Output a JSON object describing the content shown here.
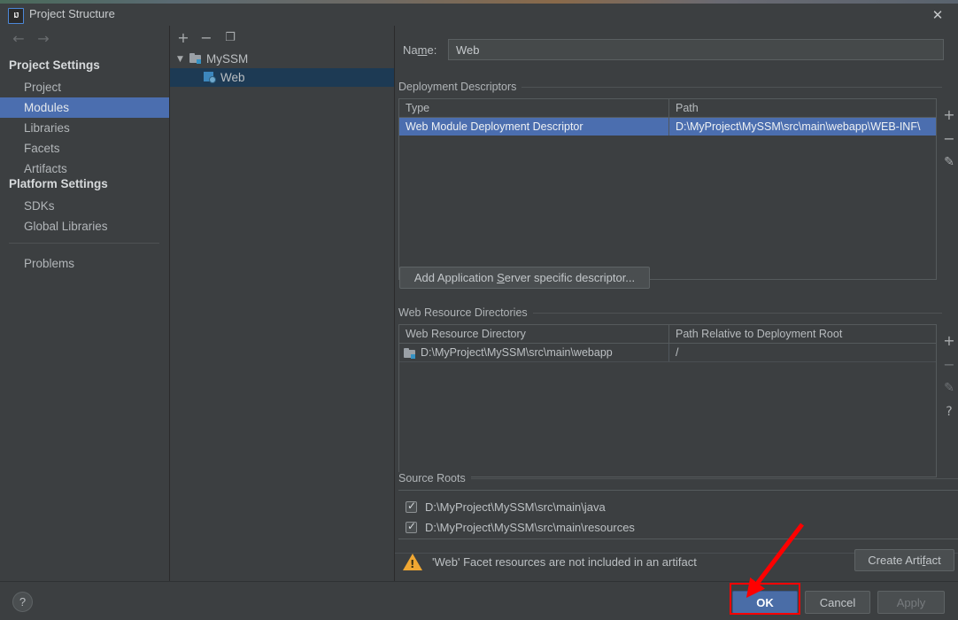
{
  "window": {
    "title": "Project Structure",
    "app_icon": "intellij-idea-icon",
    "close_icon": "✕"
  },
  "sidebar": {
    "nav": {
      "back_icon": "←",
      "forward_icon": "→"
    },
    "groups": [
      {
        "label": "Project Settings",
        "items": [
          {
            "label": "Project",
            "selected": false
          },
          {
            "label": "Modules",
            "selected": true
          },
          {
            "label": "Libraries",
            "selected": false
          },
          {
            "label": "Facets",
            "selected": false
          },
          {
            "label": "Artifacts",
            "selected": false
          }
        ]
      },
      {
        "label": "Platform Settings",
        "items": [
          {
            "label": "SDKs",
            "selected": false
          },
          {
            "label": "Global Libraries",
            "selected": false
          }
        ]
      }
    ],
    "problems": {
      "label": "Problems"
    }
  },
  "tree_pane": {
    "toolbar": [
      {
        "name": "add-module-button",
        "glyph": "+"
      },
      {
        "name": "remove-module-button",
        "glyph": "−"
      },
      {
        "name": "copy-module-button",
        "glyph": "❐"
      }
    ],
    "nodes": [
      {
        "label": "MySSM",
        "expand_glyph": "▼",
        "selected": false
      },
      {
        "label": "Web",
        "selected": true
      }
    ]
  },
  "main": {
    "name_field": {
      "label": "Name:",
      "label_pre": "Na",
      "label_accel": "m",
      "label_post": "e:",
      "value": "Web"
    },
    "deployment_descriptors": {
      "title": "Deployment Descriptors",
      "columns": [
        "Type",
        "Path"
      ],
      "rows": [
        {
          "type": "Web Module Deployment Descriptor",
          "path": "D:\\MyProject\\MySSM\\src\\main\\webapp\\WEB-INF\\",
          "selected": true
        }
      ],
      "actions": [
        {
          "name": "add-descriptor-button",
          "glyph": "+",
          "dim": false
        },
        {
          "name": "remove-descriptor-button",
          "glyph": "−",
          "dim": false
        },
        {
          "name": "edit-descriptor-button",
          "glyph": "✎",
          "dim": false
        }
      ],
      "add_server_button": {
        "pre": "Add Application ",
        "accel": "S",
        "post": "erver specific descriptor..."
      }
    },
    "web_resource_directories": {
      "title": "Web Resource Directories",
      "columns": [
        "Web Resource Directory",
        "Path Relative to Deployment Root"
      ],
      "rows": [
        {
          "directory": "D:\\MyProject\\MySSM\\src\\main\\webapp",
          "relative_path": "/"
        }
      ],
      "actions": [
        {
          "name": "add-web-resource-button",
          "glyph": "+",
          "dim": false
        },
        {
          "name": "remove-web-resource-button",
          "glyph": "−",
          "dim": true
        },
        {
          "name": "edit-web-resource-button",
          "glyph": "✎",
          "dim": true
        },
        {
          "name": "help-web-resource-button",
          "glyph": "?",
          "dim": false
        }
      ]
    },
    "source_roots": {
      "title": "Source Roots",
      "items": [
        {
          "label": "D:\\MyProject\\MySSM\\src\\main\\java",
          "checked": true
        },
        {
          "label": "D:\\MyProject\\MySSM\\src\\main\\resources",
          "checked": true
        }
      ]
    },
    "warning": {
      "icon": "warning-triangle-icon",
      "text": "'Web' Facet resources are not included in an artifact",
      "button": {
        "pre": "Create Arti",
        "accel": "f",
        "post": "act"
      }
    }
  },
  "footer": {
    "help_glyph": "?",
    "buttons": [
      {
        "name": "ok-button",
        "label": "OK",
        "style": "primary",
        "disabled": false
      },
      {
        "name": "cancel-button",
        "label": "Cancel",
        "style": "normal",
        "disabled": false
      },
      {
        "name": "apply-button",
        "label": "Apply",
        "style": "normal",
        "disabled": true
      }
    ]
  },
  "annotation": {
    "highlight_color": "#ff0000",
    "target": "ok-button"
  },
  "colors": {
    "window_bg": "#3c3f41",
    "selection_blue": "#4b6eaf",
    "tree_selection": "#1d3a54",
    "accent_warning": "#f0a732",
    "annotation_red": "#ff0000"
  }
}
